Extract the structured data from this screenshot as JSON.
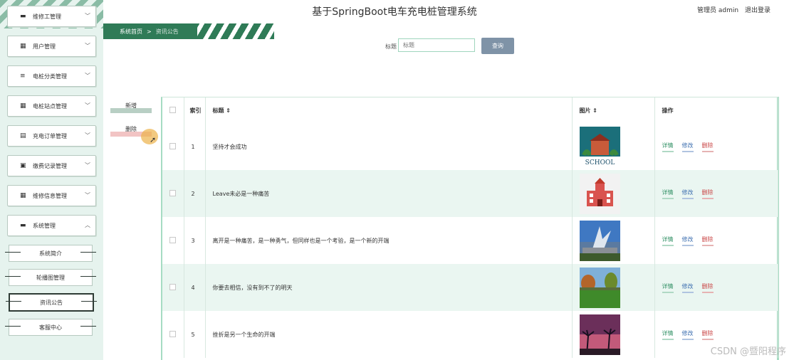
{
  "app_title": "基于SpringBoot电车充电桩管理系统",
  "header": {
    "user_label": "管理员 admin",
    "logout": "退出登录"
  },
  "breadcrumb": {
    "home": "系统首页",
    "separator": ">",
    "current": "资讯公告"
  },
  "sidebar": {
    "items": [
      {
        "label": "维修工管理",
        "icon": "monitor-icon",
        "expanded": false
      },
      {
        "label": "用户管理",
        "icon": "grid-icon",
        "expanded": false
      },
      {
        "label": "电桩分类管理",
        "icon": "list-icon",
        "expanded": false
      },
      {
        "label": "电桩站点管理",
        "icon": "grid-icon",
        "expanded": false
      },
      {
        "label": "充电订单管理",
        "icon": "doc-icon",
        "expanded": false
      },
      {
        "label": "缴费记录管理",
        "icon": "clipboard-icon",
        "expanded": false
      },
      {
        "label": "维修信息管理",
        "icon": "grid-icon",
        "expanded": false
      },
      {
        "label": "系统管理",
        "icon": "monitor-icon",
        "expanded": true
      }
    ],
    "sub_items": [
      {
        "label": "系统简介",
        "active": false
      },
      {
        "label": "轮播图管理",
        "active": false
      },
      {
        "label": "资讯公告",
        "active": true
      },
      {
        "label": "客服中心",
        "active": false
      }
    ]
  },
  "search": {
    "label": "标题",
    "placeholder": "标题",
    "button": "查询"
  },
  "actions": {
    "add": "新增",
    "delete": "删除"
  },
  "table": {
    "headers": {
      "index": "索引",
      "title": "标题 ⇕",
      "image": "图片 ⇕",
      "ops": "操作"
    },
    "op_labels": {
      "detail": "详情",
      "edit": "修改",
      "delete": "删除"
    },
    "rows": [
      {
        "index": "1",
        "title": "坚持才会成功",
        "image": "school-sign"
      },
      {
        "index": "2",
        "title": "Leave未必是一种痛苦",
        "image": "school-building"
      },
      {
        "index": "3",
        "title": "离开是一种痛苦，是一种勇气，但同样也是一个考验，是一个新的开端",
        "image": "campus-sculpture"
      },
      {
        "index": "4",
        "title": "你要去相信，没有到不了的明天",
        "image": "campus-lawn"
      },
      {
        "index": "5",
        "title": "挫折是另一个生命的开端",
        "image": "palm-sunset"
      }
    ]
  },
  "watermark": "CSDN @暨阳程序"
}
